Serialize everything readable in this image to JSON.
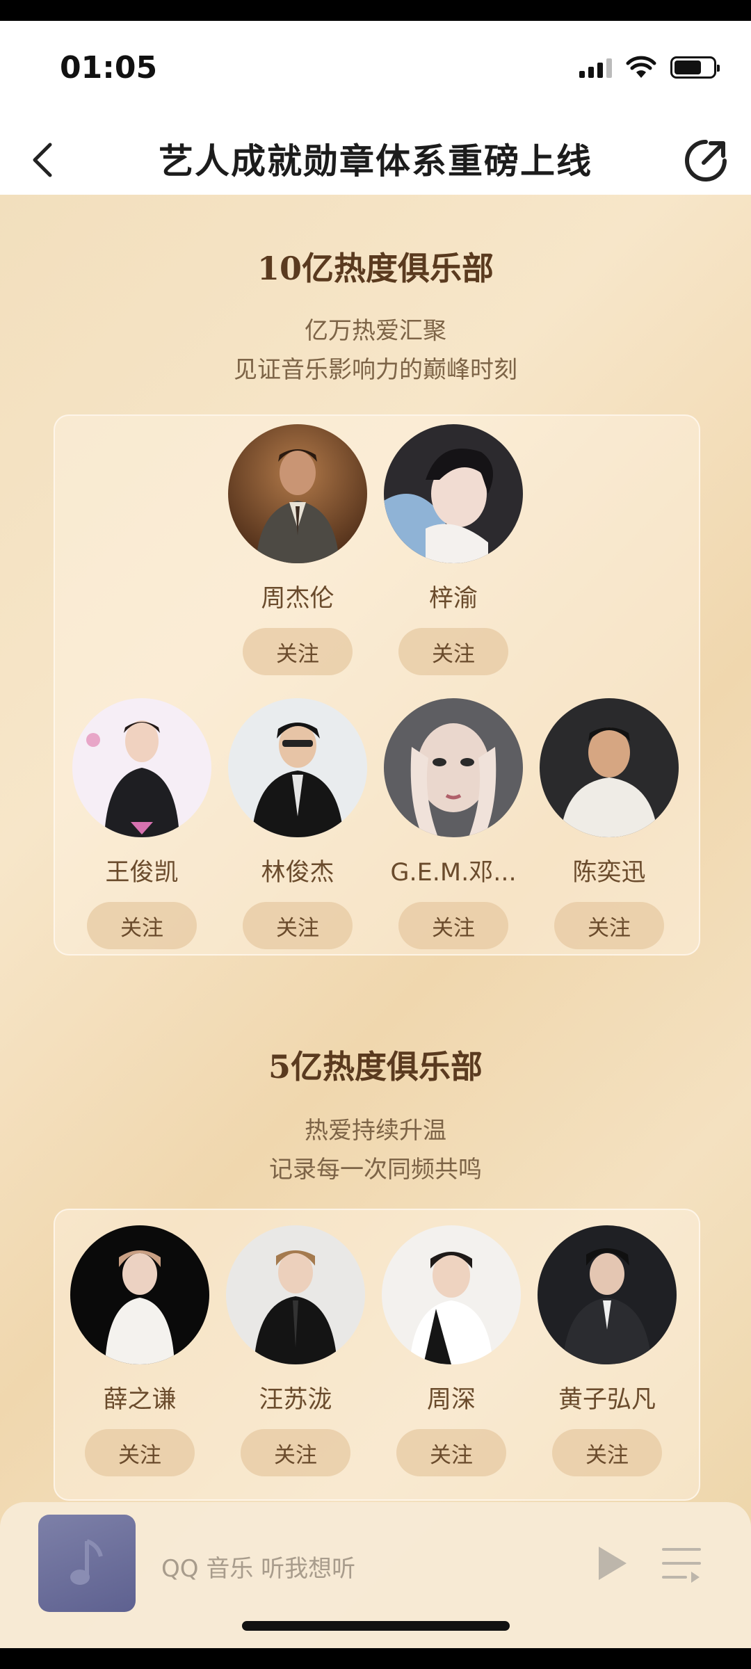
{
  "status_bar": {
    "time": "01:05"
  },
  "nav": {
    "title": "艺人成就勋章体系重磅上线"
  },
  "clubs": [
    {
      "title": "10亿热度俱乐部",
      "subtitle_lines": [
        "亿万热爱汇聚",
        "见证音乐影响力的巅峰时刻"
      ],
      "artists": [
        {
          "name": "周杰伦",
          "follow_label": "关注"
        },
        {
          "name": "梓渝",
          "follow_label": "关注"
        },
        {
          "name": "王俊凯",
          "follow_label": "关注"
        },
        {
          "name": "林俊杰",
          "follow_label": "关注"
        },
        {
          "name": "G.E.M.邓...",
          "follow_label": "关注"
        },
        {
          "name": "陈奕迅",
          "follow_label": "关注"
        }
      ]
    },
    {
      "title": "5亿热度俱乐部",
      "subtitle_lines": [
        "热爱持续升温",
        "记录每一次同频共鸣"
      ],
      "artists": [
        {
          "name": "薛之谦",
          "follow_label": "关注"
        },
        {
          "name": "汪苏泷",
          "follow_label": "关注"
        },
        {
          "name": "周深",
          "follow_label": "关注"
        },
        {
          "name": "黄子弘凡",
          "follow_label": "关注"
        }
      ]
    }
  ],
  "player": {
    "text": "QQ 音乐 听我想听"
  },
  "colors": {
    "accent_text": "#5a3a1f",
    "button_bg": "#e5c8a0",
    "background": "#f2dfbd"
  }
}
